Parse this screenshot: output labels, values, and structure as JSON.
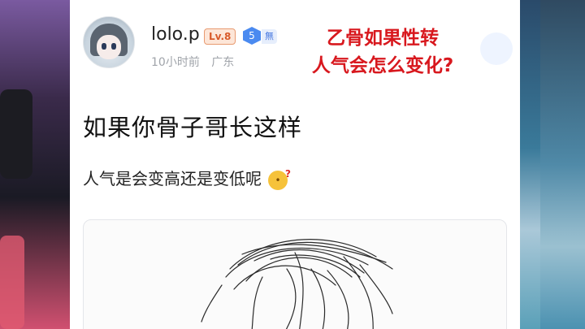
{
  "user": {
    "name": "lolo.p",
    "level": "Lv.8",
    "badge_number": "5",
    "badge_text": "無",
    "time": "10小时前",
    "location": "广东"
  },
  "overlay_caption": {
    "line1": "乙骨如果性转",
    "line2": "人气会怎么变化?"
  },
  "post": {
    "title": "如果你骨子哥长这样",
    "body": "人气是会变高还是变低呢"
  },
  "colors": {
    "caption_red": "#d8181e",
    "level_orange": "#d85a2a",
    "badge_blue": "#4a8af0"
  },
  "icons": [
    "avatar-icon",
    "thinking-emoji-icon",
    "sketch-image"
  ]
}
